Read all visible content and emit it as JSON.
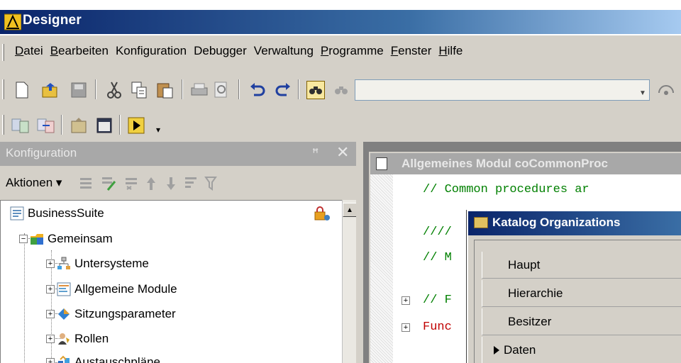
{
  "window": {
    "title": "Designer"
  },
  "menu": [
    {
      "pre": "",
      "acc": "D",
      "post": "atei"
    },
    {
      "pre": "",
      "acc": "B",
      "post": "earbeiten"
    },
    {
      "pre": "Konfiguration",
      "acc": "",
      "post": ""
    },
    {
      "pre": "Debugger",
      "acc": "",
      "post": ""
    },
    {
      "pre": "Verwaltung",
      "acc": "",
      "post": ""
    },
    {
      "pre": "",
      "acc": "P",
      "post": "rogramme"
    },
    {
      "pre": "",
      "acc": "F",
      "post": "enster"
    },
    {
      "pre": "",
      "acc": "H",
      "post": "ilfe"
    }
  ],
  "search": {
    "value": ""
  },
  "left_pane": {
    "title": "Konfiguration",
    "pin": "ꟸ",
    "close": "✕",
    "actions_label": "Aktionen ▾"
  },
  "tree": [
    {
      "label": "BusinessSuite",
      "icon": "config-icon"
    },
    {
      "label": "Gemeinsam",
      "icon": "folder-icon",
      "expander": "−"
    },
    {
      "label": "Untersysteme",
      "icon": "subsystems-icon",
      "expander": "+"
    },
    {
      "label": "Allgemeine Module",
      "icon": "module-icon",
      "expander": "+"
    },
    {
      "label": "Sitzungsparameter",
      "icon": "session-params-icon",
      "expander": "+"
    },
    {
      "label": "Rollen",
      "icon": "roles-icon",
      "expander": "+"
    },
    {
      "label": "Austauschpläne",
      "icon": "exchange-plans-icon",
      "expander": "+"
    }
  ],
  "editor": {
    "title": "Allgemeines Modul coCommonProc",
    "lines": [
      {
        "text": "// Common procedures ar",
        "color": "green"
      },
      {
        "text": "////",
        "color": "green"
      },
      {
        "text": "// M",
        "color": "green"
      },
      {
        "text": "// F",
        "color": "green"
      },
      {
        "text": "Func",
        "color": "red"
      }
    ]
  },
  "dialog": {
    "title": "Katalog Organizations",
    "tabs": [
      "Haupt",
      "Hierarchie",
      "Besitzer",
      "Daten"
    ],
    "active_tab": "Daten"
  }
}
